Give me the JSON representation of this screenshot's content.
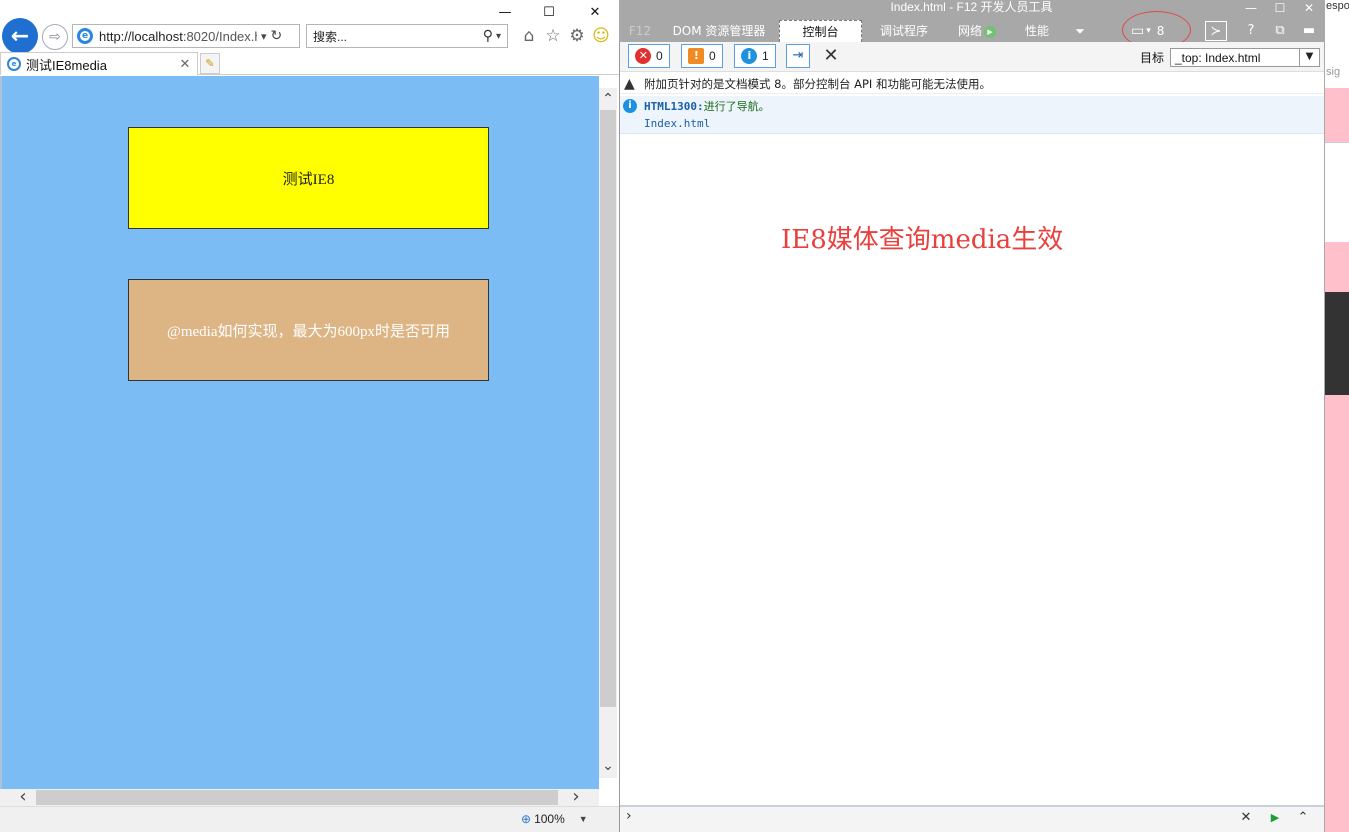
{
  "ie": {
    "caption": {
      "minimize": "—",
      "maximize": "☐",
      "close": "✕"
    },
    "nav": {
      "back": "←",
      "forward": "⇨"
    },
    "address": {
      "url_main": "http://localhost",
      "url_rest": ":8020/Index.h",
      "dropdown": "▾",
      "refresh": "↻"
    },
    "search": {
      "placeholder": "搜索...",
      "icon": "⚲",
      "dropdown": "▾"
    },
    "toolbar_icons": {
      "home": "⌂",
      "favorites": "☆",
      "settings": "⚙",
      "feedback": "☺"
    },
    "tab": {
      "title": "测试IE8media",
      "close": "✕",
      "new_tab": "✎"
    },
    "page": {
      "box1_text": "测试IE8",
      "box2_text": "@media如何实现，最大为600px时是否可用"
    },
    "scroll": {
      "up": "⌃",
      "down": "⌄",
      "left": "‹",
      "right": "›"
    },
    "status": {
      "zoom": "100%",
      "zoom_icon": "⊕",
      "zoom_arrow": "▼"
    }
  },
  "devtools": {
    "window_title": "Index.html - F12 开发人员工具",
    "caption": {
      "minimize": "—",
      "maximize": "☐",
      "close": "✕"
    },
    "tabs": {
      "f12": "F12",
      "dom": "DOM 资源管理器",
      "console": "控制台",
      "debugger": "调试程序",
      "network": "网络",
      "performance": "性能",
      "more": "⏷"
    },
    "emulation": {
      "icon": "▭",
      "arrow": "▾",
      "document_mode": "8"
    },
    "right_icons": {
      "console_toggle": "≻",
      "help": "?",
      "undock": "⧉",
      "dock": "▬"
    },
    "toolbar": {
      "errors": {
        "icon": "✕",
        "count": "0"
      },
      "warnings": {
        "icon": "!",
        "count": "0"
      },
      "info": {
        "icon": "i",
        "count": "1"
      },
      "clear_on_navigate": "⇥",
      "clear": "✕",
      "target_label": "目标",
      "target_value": "_top: Index.html",
      "target_arrow": "▼"
    },
    "messages": {
      "warning_icon": "▲",
      "warning_text": "附加页针对的是文档模式 8。部分控制台 API 和功能可能无法使用。",
      "info_icon": "i",
      "info_code": "HTML1300:",
      "info_text": " 进行了导航。",
      "info_source": "Index.html"
    },
    "annotation": "IE8媒体查询media生效",
    "input_bar": {
      "prompt": "›",
      "clear": "✕",
      "run": "▶",
      "expand": "⌃"
    }
  },
  "background_window": {
    "text_top": "espo",
    "text_mid": "sig"
  },
  "colors": {
    "page_bg": "#7bbcf4",
    "box1": "#ffff00",
    "box2": "#ddb585",
    "annotation": "#e8403c",
    "bg_window": "#ffc0cb",
    "error_icon": "#e03030",
    "warning_icon": "#f08a24",
    "info_icon": "#1e90e0"
  }
}
